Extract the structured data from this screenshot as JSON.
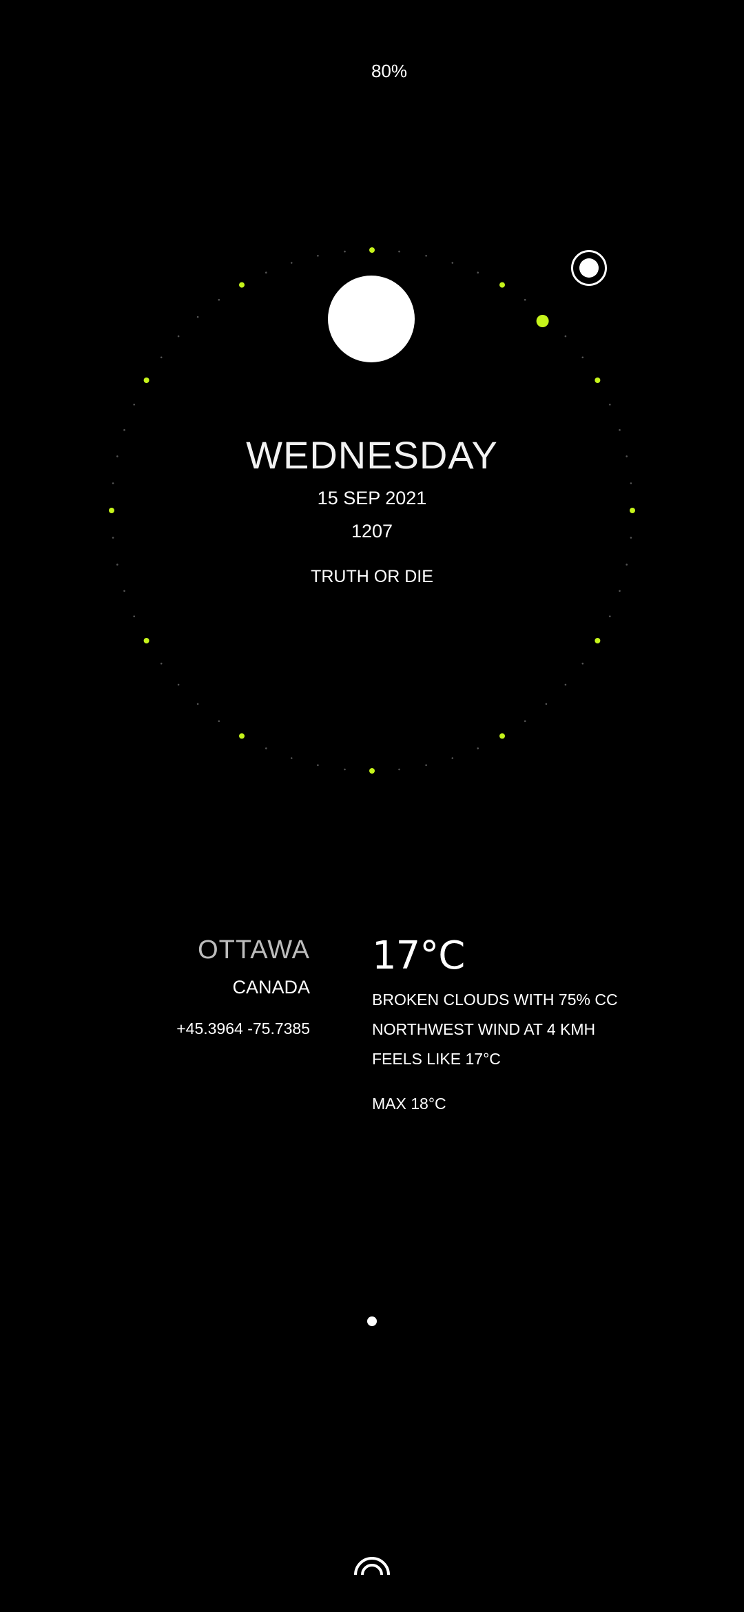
{
  "status": {
    "battery": "80%"
  },
  "date_block": {
    "day": "WEDNESDAY",
    "date": "15 SEP 2021",
    "time": "1207",
    "motto": "TRUTH OR DIE"
  },
  "location": {
    "city": "OTTAWA",
    "country": "CANADA",
    "coordinates": "+45.3964 -75.7385"
  },
  "weather": {
    "temperature": "17°C",
    "clouds": "BROKEN CLOUDS WITH 75% CC",
    "wind": "NORTHWEST WIND AT 4 KMH",
    "feels_like": "FEELS LIKE 17°C",
    "max": "MAX 18°C"
  },
  "colors": {
    "background": "#000000",
    "accent": "#c6f41b",
    "text": "#ffffff"
  },
  "icons": {
    "sun": "sun-disc-icon",
    "toggle": "record-toggle-icon",
    "page_dot": "page-indicator-dot",
    "bottom": "arc-icon"
  }
}
